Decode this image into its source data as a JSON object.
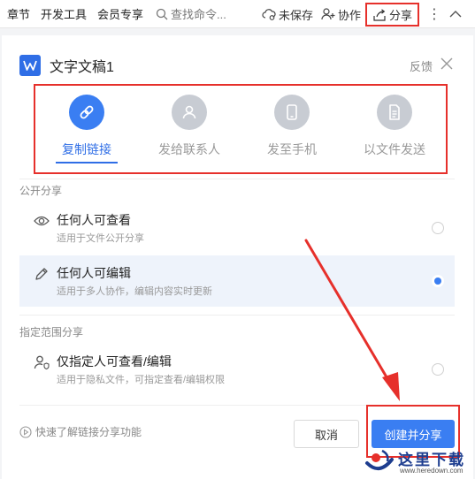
{
  "toolbar": {
    "items": [
      "章节",
      "开发工具",
      "会员专享"
    ],
    "search_placeholder": "查找命令...",
    "unsaved": "未保存",
    "collab": "协作",
    "share": "分享"
  },
  "dialog": {
    "title": "文字文稿1",
    "feedback": "反馈",
    "methods": [
      {
        "label": "复制链接",
        "icon": "link-icon",
        "active": true
      },
      {
        "label": "发给联系人",
        "icon": "person-icon",
        "active": false
      },
      {
        "label": "发至手机",
        "icon": "phone-icon",
        "active": false
      },
      {
        "label": "以文件发送",
        "icon": "file-icon",
        "active": false
      }
    ],
    "public_section": "公开分享",
    "options": [
      {
        "title": "任何人可查看",
        "desc": "适用于文件公开分享",
        "icon": "eye-icon",
        "selected": false
      },
      {
        "title": "任何人可编辑",
        "desc": "适用于多人协作，编辑内容实时更新",
        "icon": "pencil-icon",
        "selected": true
      }
    ],
    "scoped_section": "指定范围分享",
    "scoped_option": {
      "title": "仅指定人可查看/编辑",
      "desc": "适用于隐私文件，可指定查看/编辑权限",
      "icon": "user-shield-icon",
      "selected": false
    },
    "learn_link": "快速了解链接分享功能",
    "cancel": "取消",
    "create": "创建并分享"
  },
  "watermark": {
    "text": "这里下载",
    "url": "www.heredown.com"
  },
  "colors": {
    "accent": "#3a7ef2",
    "highlight": "#e6302b"
  }
}
